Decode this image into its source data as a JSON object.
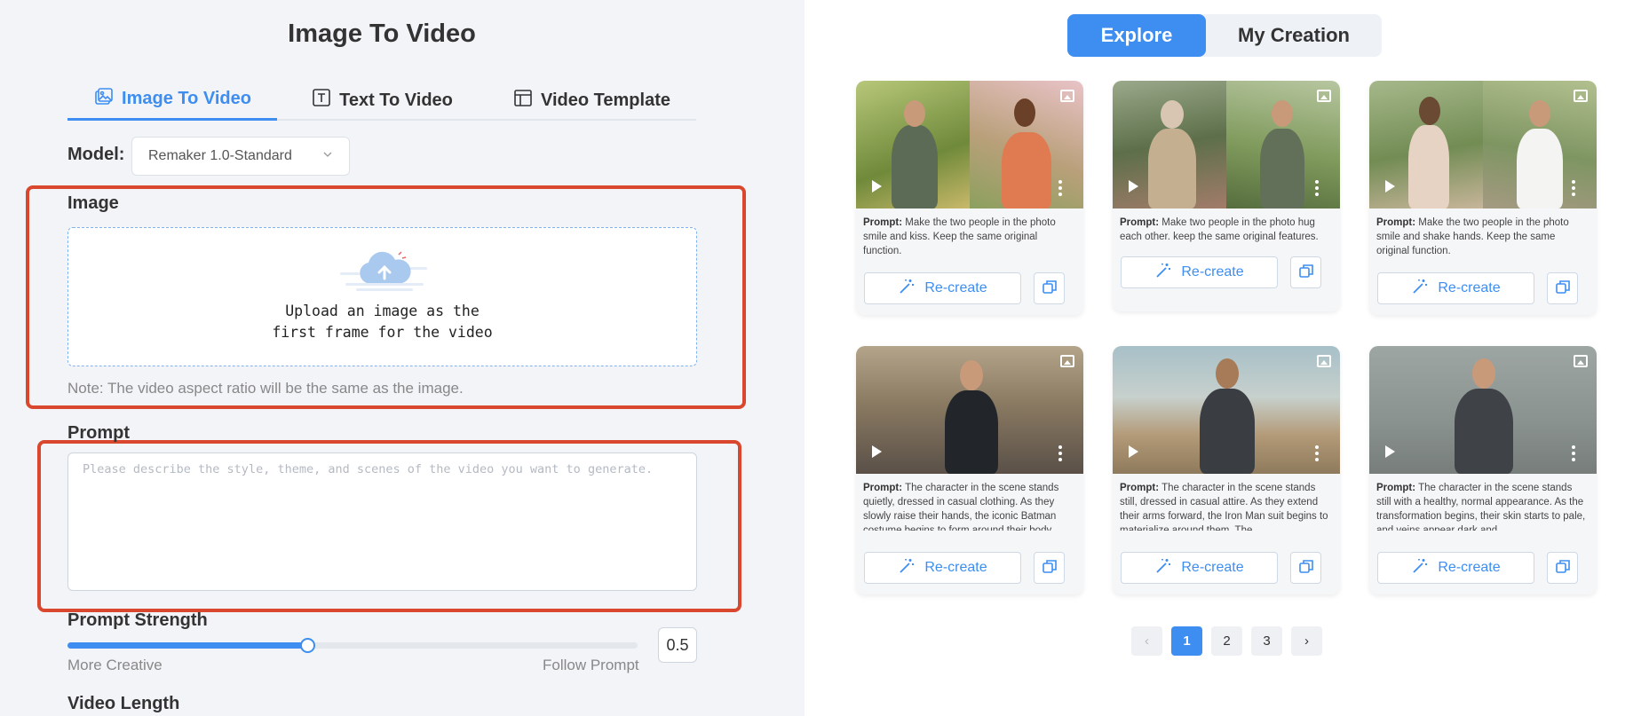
{
  "left": {
    "title": "Image To Video",
    "tabs": [
      {
        "label": "Image To Video",
        "icon": "image-icon",
        "active": true
      },
      {
        "label": "Text To Video",
        "icon": "text-icon",
        "active": false
      },
      {
        "label": "Video Template",
        "icon": "template-icon",
        "active": false
      }
    ],
    "model": {
      "label": "Model:",
      "value": "Remaker 1.0-Standard"
    },
    "image": {
      "label": "Image",
      "upload_text_line1": "Upload an image as the",
      "upload_text_line2": "first frame for the video",
      "note": "Note: The video aspect ratio will be the same as the image."
    },
    "prompt": {
      "label": "Prompt",
      "placeholder": "Please describe the style, theme, and scenes of the video you want to generate.",
      "value": ""
    },
    "prompt_strength": {
      "label": "Prompt Strength",
      "value": "0.5",
      "fraction": 0.42,
      "min_label": "More Creative",
      "max_label": "Follow Prompt"
    },
    "video_length": {
      "label": "Video Length"
    }
  },
  "right": {
    "tabs": [
      {
        "label": "Explore",
        "active": true
      },
      {
        "label": "My Creation",
        "active": false
      }
    ],
    "cards": [
      {
        "prompt_label": "Prompt:",
        "prompt": "Make the two people in the photo smile and kiss. Keep the same original function.",
        "button": "Re-create"
      },
      {
        "prompt_label": "Prompt:",
        "prompt": "Make two people in the photo hug each other. keep the same original features.",
        "button": "Re-create"
      },
      {
        "prompt_label": "Prompt:",
        "prompt": "Make the two people in the photo smile and shake hands. Keep the same original function.",
        "button": "Re-create"
      },
      {
        "prompt_label": "Prompt:",
        "prompt": "The character in the scene stands quietly, dressed in casual clothing. As they slowly raise their hands, the iconic Batman costume begins to form around their body.…",
        "button": "Re-create"
      },
      {
        "prompt_label": "Prompt:",
        "prompt": "The character in the scene stands still, dressed in casual attire. As they extend their arms forward, the Iron Man suit begins to materialize around them. The…",
        "button": "Re-create"
      },
      {
        "prompt_label": "Prompt:",
        "prompt": "The character in the scene stands still with a healthy, normal appearance. As the transformation begins, their skin starts to pale, and veins appear dark and…",
        "button": "Re-create"
      }
    ],
    "pagination": {
      "pages": [
        "1",
        "2",
        "3"
      ],
      "current": "1",
      "prev": "‹",
      "next": "›"
    }
  },
  "colors": {
    "accent": "#3d8ef0",
    "highlight_border": "#d9482e",
    "left_bg": "#f2f4f8"
  }
}
